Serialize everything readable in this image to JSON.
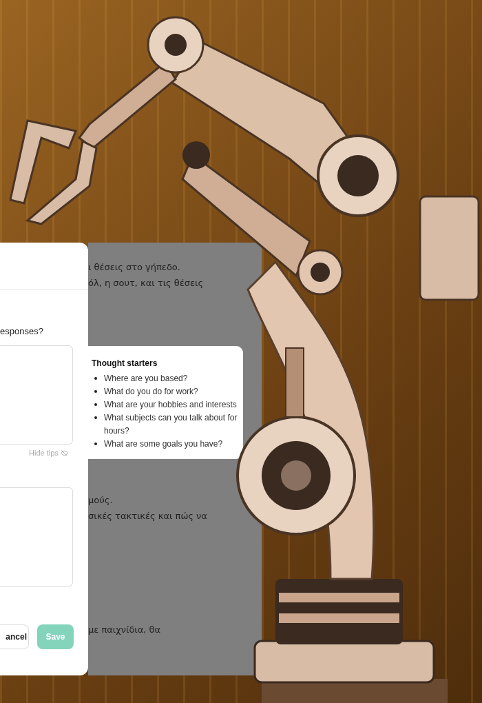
{
  "dialog": {
    "question": "esponses?",
    "hide_tips": "Hide tips",
    "buttons": [
      {
        "label": "ancel",
        "kind": "secondary"
      },
      {
        "label": "Save",
        "kind": "primary"
      }
    ]
  },
  "tips": {
    "title": "Thought starters",
    "items": [
      "Where are you based?",
      "What do you do for work?",
      "What are your hobbies and interests",
      "What subjects can you talk about for hours?",
      "What are some goals you have?"
    ]
  },
  "background_text": [
    [
      "ι θέσεις στο γήπεδο.",
      "όλ, η σουτ, και τις θέσεις"
    ],
    [
      "μούς.",
      "σικές τακτικές και πώς να"
    ],
    [
      "με παιχνίδια, θα"
    ]
  ]
}
